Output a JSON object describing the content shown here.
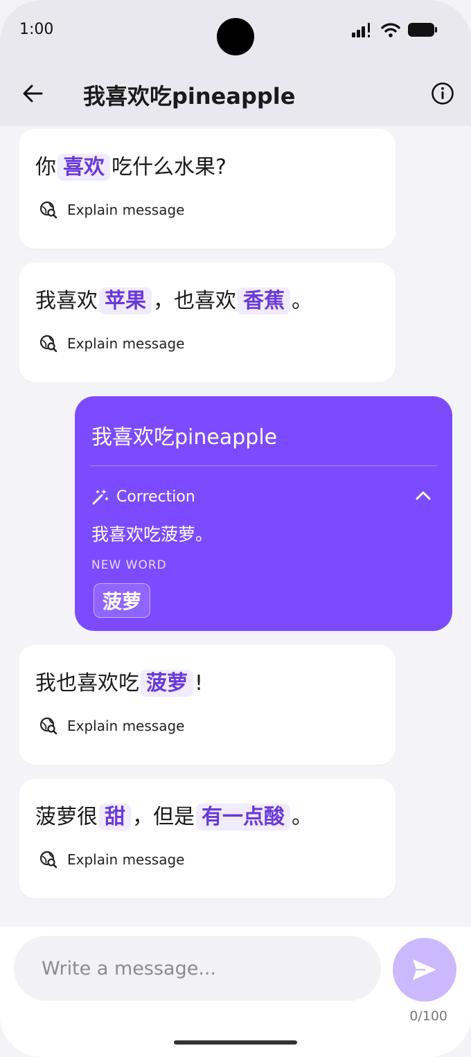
{
  "status": {
    "time": "1:00"
  },
  "header": {
    "title": "我喜欢吃pineapple"
  },
  "messages": [
    {
      "pre": "你",
      "h1": "喜欢",
      "mid": "吃什么水果?",
      "explain": "Explain message"
    },
    {
      "pre": "我喜欢",
      "h1": "苹果",
      "mid": "，也喜欢",
      "h2": "香蕉",
      "post": "。",
      "explain": "Explain message"
    },
    {
      "pre": "我也喜欢吃",
      "h1": "菠萝",
      "mid": "!",
      "explain": "Explain message"
    },
    {
      "pre": "菠萝很",
      "h1": "甜",
      "mid": "，但是",
      "h2": "有一点酸",
      "post": "。",
      "explain": "Explain message"
    }
  ],
  "user_message": {
    "text": "我喜欢吃pineapple",
    "correction_label": "Correction",
    "correction_text": "我喜欢吃菠萝。",
    "new_word_label": "NEW WORD",
    "new_word": "菠萝"
  },
  "composer": {
    "placeholder": "Write a message...",
    "counter": "0/100"
  },
  "colors": {
    "accent": "#7d4bff",
    "highlight_bg": "#f0ebfd",
    "highlight_text": "#6a39d9"
  }
}
